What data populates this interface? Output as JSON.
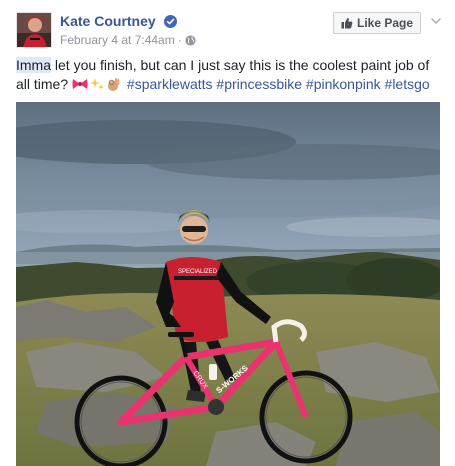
{
  "post": {
    "author_name": "Kate Courtney",
    "date": "February 4 at 7:44am",
    "separator": "·",
    "like_page_label": "Like Page",
    "text": {
      "mention": "Imma",
      "body": " let you finish, but can I just say this is the coolest paint job of all time?",
      "hashtags": [
        "#sparklewatts",
        "#princessbike",
        "#pinkonpink",
        "#letsgo"
      ]
    },
    "emojis": [
      "bow-emoji",
      "sparkles-emoji",
      "ok-hand-emoji"
    ],
    "photo": {
      "description_icon": "cyclist-photo",
      "jersey_text": "SPECIALIZED",
      "frame_text": "CRUX",
      "downtube_text": "S-WORKS"
    }
  },
  "colors": {
    "link": "#365899",
    "verified": "#4267b2",
    "meta": "#90949c",
    "text": "#1d2129",
    "bike_pink": "#e8336e",
    "jersey_red": "#c8202e"
  }
}
